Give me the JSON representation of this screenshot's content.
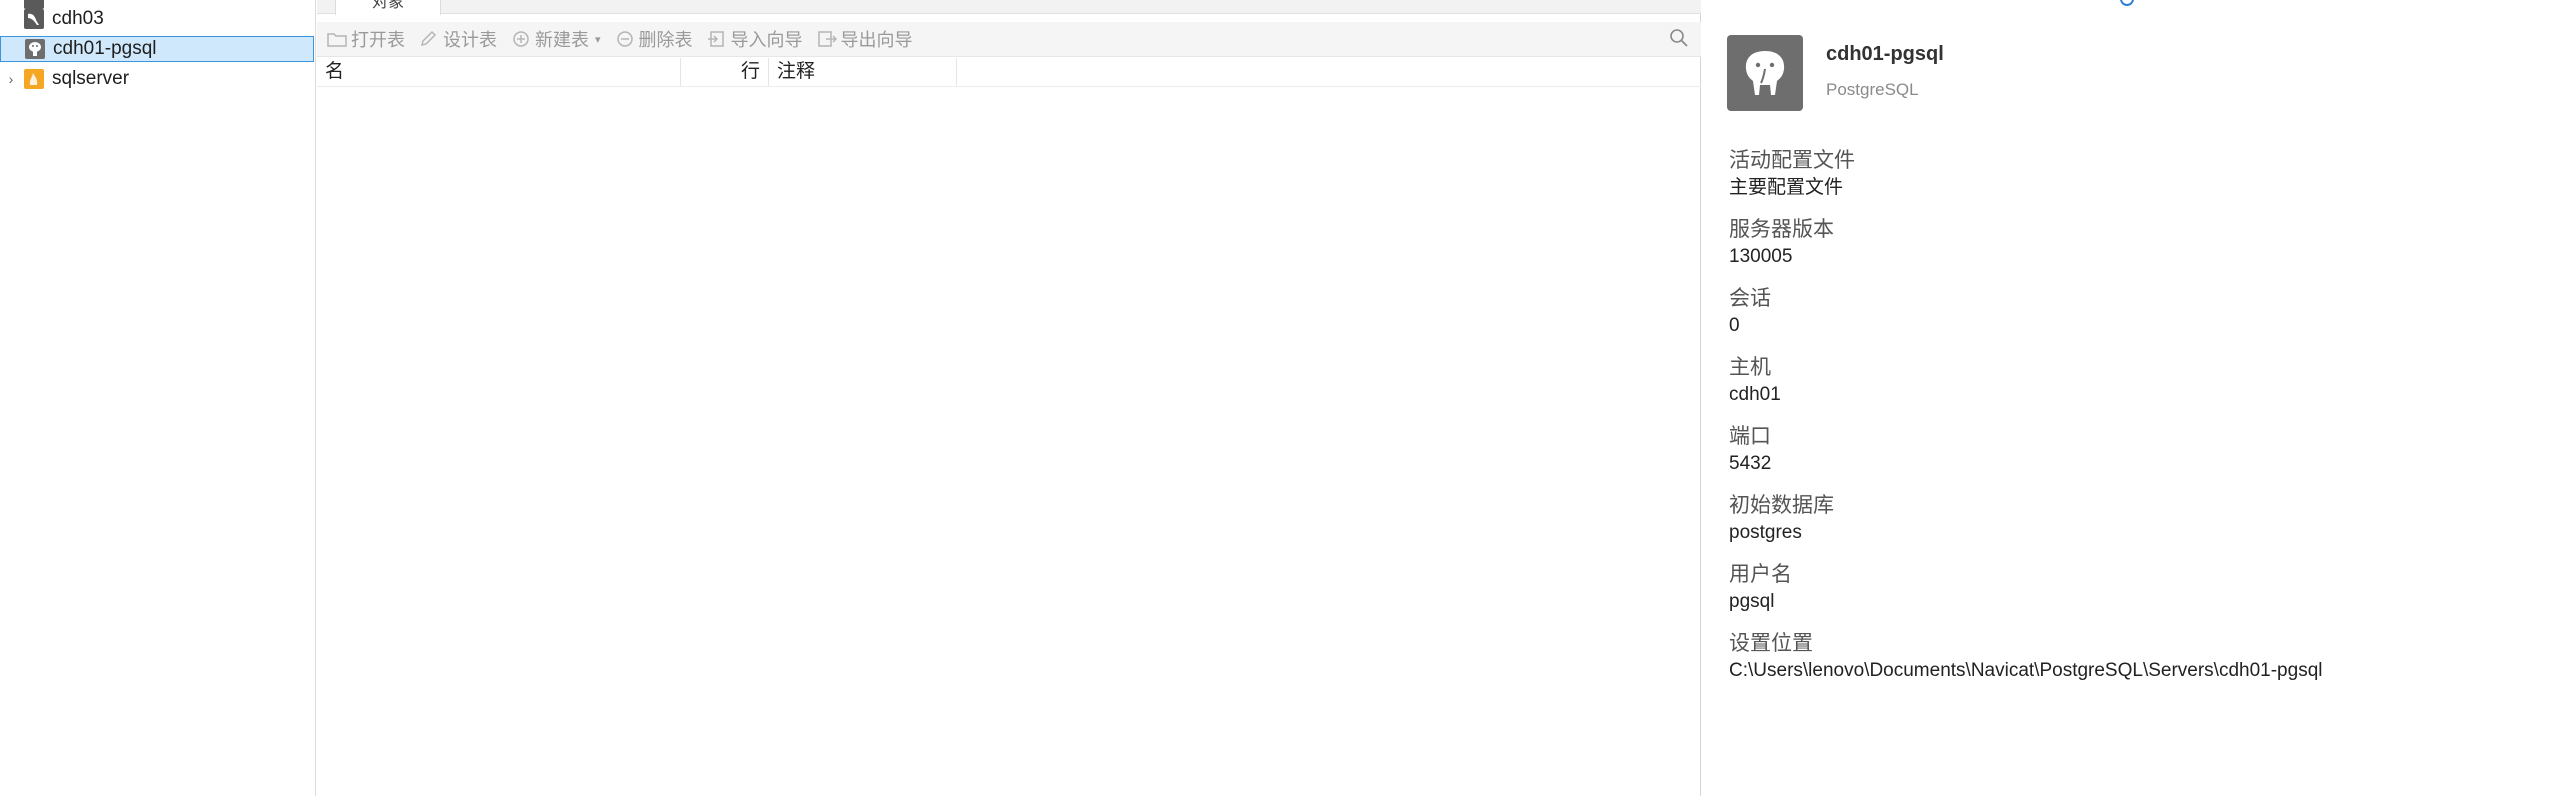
{
  "nav": {
    "items": [
      {
        "label": "cdh03",
        "icon": "mysql-connection-icon",
        "selected": false
      },
      {
        "label": "cdh01-pgsql",
        "icon": "postgresql-connection-icon",
        "selected": true
      },
      {
        "label": "sqlserver",
        "icon": "sqlserver-connection-icon",
        "selected": false,
        "expandable": true
      }
    ]
  },
  "center": {
    "tab_label": "对象",
    "toolbar": {
      "open_table": "打开表",
      "design_table": "设计表",
      "new_table": "新建表",
      "delete_table": "删除表",
      "import_wizard": "导入向导",
      "export_wizard": "导出向导"
    },
    "columns": {
      "name": "名",
      "rows": "行",
      "comment": "注释"
    }
  },
  "info": {
    "name": "cdh01-pgsql",
    "type": "PostgreSQL",
    "properties": [
      {
        "key": "活动配置文件",
        "value": "主要配置文件"
      },
      {
        "key": "服务器版本",
        "value": "130005"
      },
      {
        "key": "会话",
        "value": "0"
      },
      {
        "key": "主机",
        "value": "cdh01"
      },
      {
        "key": "端口",
        "value": "5432"
      },
      {
        "key": "初始数据库",
        "value": "postgres"
      },
      {
        "key": "用户名",
        "value": "pgsql"
      },
      {
        "key": "设置位置",
        "value": "C:\\Users\\lenovo\\Documents\\Navicat\\PostgreSQL\\Servers\\cdh01-pgsql"
      }
    ]
  },
  "colors": {
    "selection_bg": "#cfe8fc",
    "selection_border": "#3a94e0",
    "toolbar_disabled_text": "#9a9a9a",
    "pg_icon_bg": "#6e6e6e",
    "sqlserver_icon": "#f5a623"
  }
}
